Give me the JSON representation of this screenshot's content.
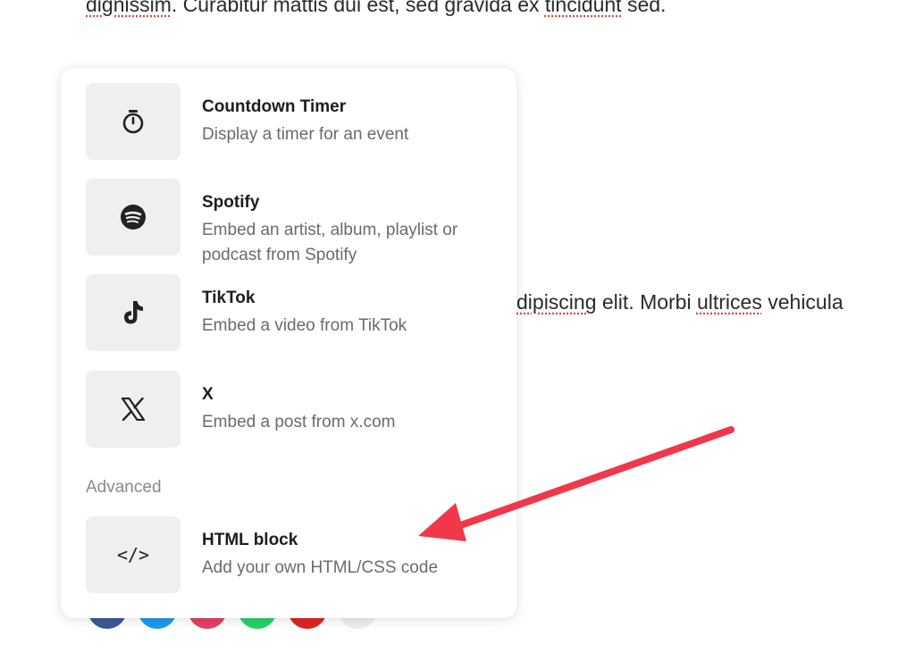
{
  "article": {
    "top_line": {
      "before": "dignissim",
      "middle": ". Curabitur mattis dui est, sed gravida ex ",
      "misspelled": "tincidunt",
      "after": " sed."
    },
    "mid_line": {
      "first": "dipiscing",
      "middle": " elit. Morbi ",
      "misspelled": "ultrices",
      "after": " vehicula"
    }
  },
  "menu": {
    "items": [
      {
        "title": "Countdown Timer",
        "description": "Display a timer for an event",
        "icon": "stopwatch-icon"
      },
      {
        "title": "Spotify",
        "description": "Embed an artist, album, playlist or podcast from Spotify",
        "icon": "spotify-icon"
      },
      {
        "title": "TikTok",
        "description": "Embed a video from TikTok",
        "icon": "tiktok-icon"
      },
      {
        "title": "X",
        "description": "Embed a post from x.com",
        "icon": "x-logo-icon"
      }
    ],
    "section_advanced": "Advanced",
    "advanced_items": [
      {
        "title": "HTML block",
        "description": "Add your own HTML/CSS code",
        "icon": "code-icon",
        "glyph": "</>"
      }
    ]
  },
  "social_colors": [
    "#3b5998",
    "#1d9bf0",
    "#e4405f",
    "#25d366",
    "#e02424",
    "#eeeeee"
  ],
  "colors": {
    "arrow": "#f0384a",
    "tile": "#efefef",
    "muted_text": "#6b6b6b"
  }
}
